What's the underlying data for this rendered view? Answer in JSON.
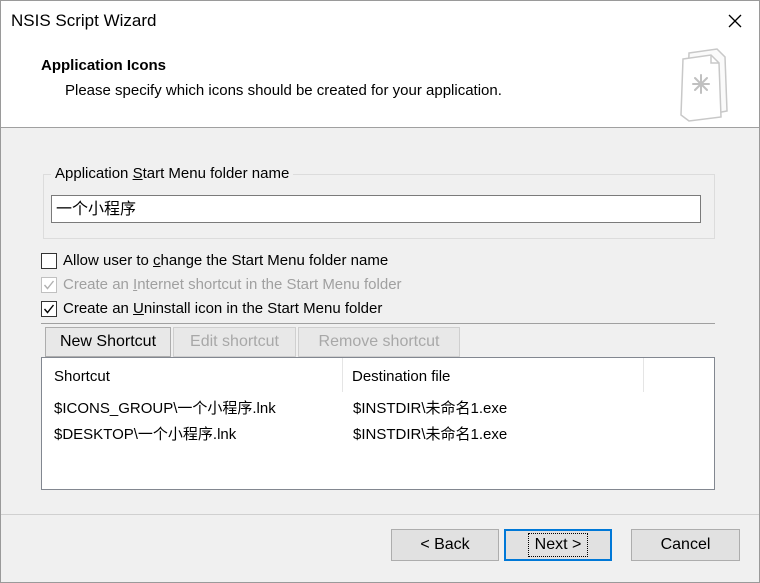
{
  "window": {
    "title": "NSIS Script Wizard",
    "close_glyph": "✕"
  },
  "header": {
    "title": "Application Icons",
    "subtitle": "Please specify which icons should be created for your application.",
    "icon": "wizard-page-icon"
  },
  "start_menu": {
    "group_label_pre": "Application ",
    "group_label_key": "S",
    "group_label_post": "tart Menu folder name",
    "folder_name": "一个小程序"
  },
  "options": [
    {
      "pre": "Allow user to ",
      "key": "c",
      "post": "hange the Start Menu folder name",
      "checked": false,
      "enabled": true
    },
    {
      "pre": "Create an ",
      "key": "I",
      "post": "nternet shortcut in the Start Menu folder",
      "checked": true,
      "enabled": false
    },
    {
      "pre": "Create an ",
      "key": "U",
      "post": "ninstall icon in the Start Menu folder",
      "checked": true,
      "enabled": true
    }
  ],
  "shortcut_buttons": {
    "new": "New Shortcut",
    "edit": "Edit shortcut",
    "remove": "Remove shortcut"
  },
  "shortcuts_table": {
    "columns": [
      "Shortcut",
      "Destination file"
    ],
    "rows": [
      {
        "shortcut": "$ICONS_GROUP\\一个小程序.lnk",
        "destination": "$INSTDIR\\未命名1.exe"
      },
      {
        "shortcut": "$DESKTOP\\一个小程序.lnk",
        "destination": "$INSTDIR\\未命名1.exe"
      }
    ]
  },
  "footer": {
    "back": "< Back",
    "next": "Next >",
    "cancel": "Cancel"
  }
}
